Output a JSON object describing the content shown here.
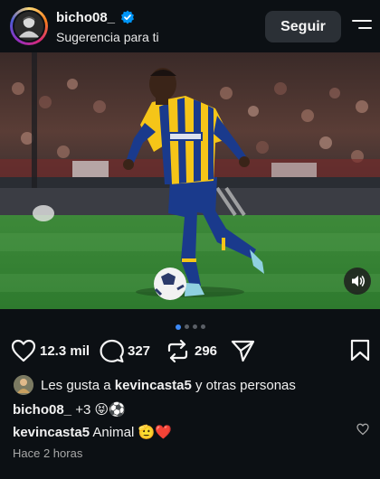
{
  "header": {
    "username": "bicho08_",
    "subtitle": "Sugerencia para ti",
    "follow_label": "Seguir"
  },
  "carousel": {
    "count": 4,
    "active_index": 0
  },
  "actions": {
    "likes": "12.3 mil",
    "comments": "327",
    "reposts": "296"
  },
  "liked_by": {
    "prefix": "Les gusta a",
    "user": "kevincasta5",
    "suffix": "y otras personas"
  },
  "caption": {
    "user": "bicho08_",
    "text": "+3 😝⚽"
  },
  "comment": {
    "user": "kevincasta5",
    "text": "Animal 🫡❤️"
  },
  "timestamp": "Hace 2 horas",
  "colors": {
    "background": "#0c1014",
    "verified": "#0095f6",
    "active_dot": "#3d8af7",
    "jersey_blue": "#1a3a8c",
    "jersey_yellow": "#f5c518",
    "heart_red": "#ff3040"
  },
  "icons": [
    "verified-badge-icon",
    "menu-icon",
    "sound-on-icon",
    "heart-icon",
    "comment-icon",
    "repost-icon",
    "share-icon",
    "bookmark-icon"
  ]
}
